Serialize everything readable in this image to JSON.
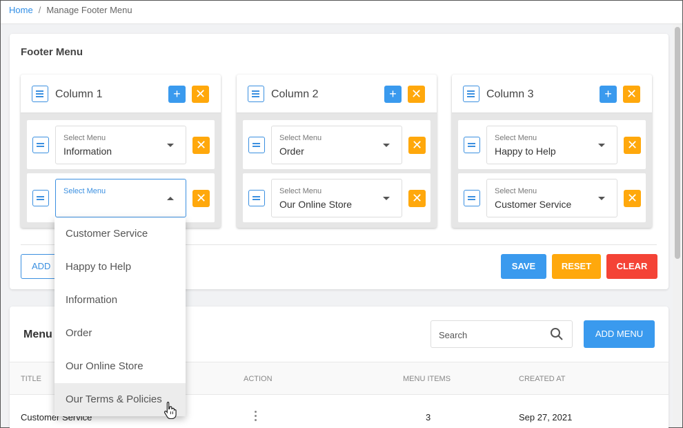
{
  "breadcrumb": {
    "home": "Home",
    "separator": "/",
    "current": "Manage Footer Menu"
  },
  "footer_card": {
    "title": "Footer Menu",
    "columns": [
      {
        "name": "Column 1",
        "rows": [
          {
            "label": "Select Menu",
            "value": "Information",
            "open": false
          },
          {
            "label": "Select Menu",
            "value": "",
            "open": true
          }
        ]
      },
      {
        "name": "Column 2",
        "rows": [
          {
            "label": "Select Menu",
            "value": "Order",
            "open": false
          },
          {
            "label": "Select Menu",
            "value": "Our Online Store",
            "open": false
          }
        ]
      },
      {
        "name": "Column 3",
        "rows": [
          {
            "label": "Select Menu",
            "value": "Happy to Help",
            "open": false
          },
          {
            "label": "Select Menu",
            "value": "Customer Service",
            "open": false
          }
        ]
      }
    ],
    "add_column_label": "ADD",
    "save_label": "SAVE",
    "reset_label": "RESET",
    "clear_label": "CLEAR",
    "icons": {
      "plus": "+",
      "close": "✕"
    }
  },
  "dropdown": {
    "options": [
      "Customer Service",
      "Happy to Help",
      "Information",
      "Order",
      "Our Online Store",
      "Our Terms & Policies"
    ],
    "hovered_index": 5
  },
  "menus_card": {
    "title": "Menu",
    "search_placeholder": "Search",
    "add_menu_label": "ADD MENU",
    "columns": {
      "title": "TITLE",
      "action": "ACTION",
      "menu_items": "MENU ITEMS",
      "created_at": "CREATED AT"
    },
    "rows": [
      {
        "title": "Customer Service",
        "menu_items": "3",
        "created_at": "Sep 27, 2021"
      }
    ]
  },
  "colors": {
    "primary": "#3a9aee",
    "warning": "#ffa80c",
    "danger": "#f44336",
    "link": "#2f8ee6"
  }
}
